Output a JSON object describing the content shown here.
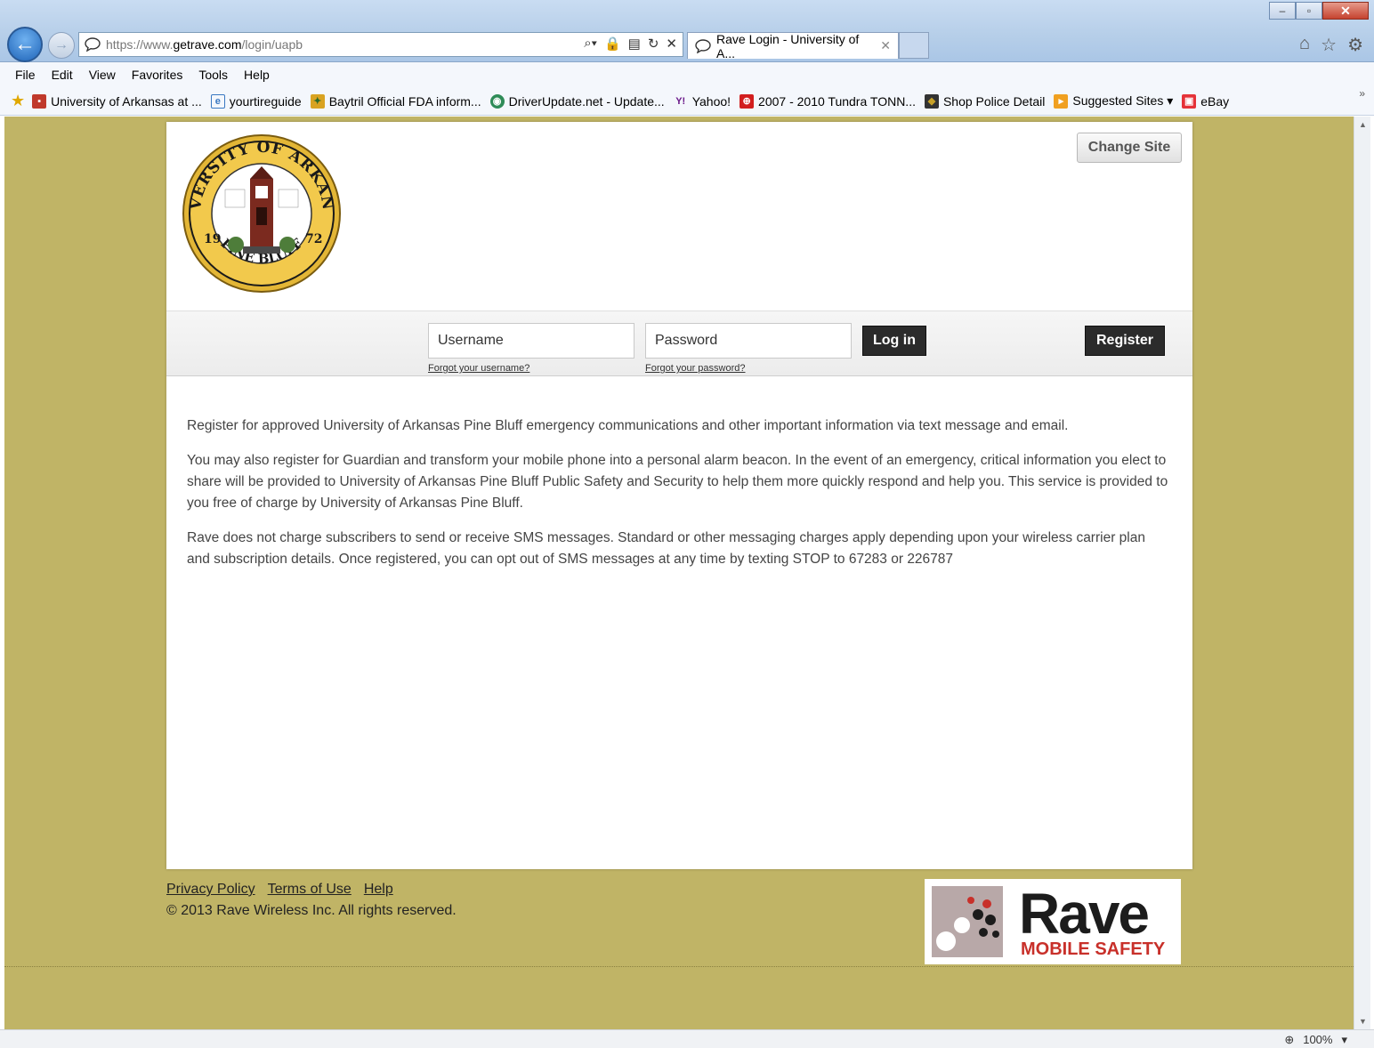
{
  "browser": {
    "url_scheme": "https://www.",
    "url_host": "getrave.com",
    "url_path": "/login/uapb",
    "tab_title": "Rave Login - University of A...",
    "menu": [
      "File",
      "Edit",
      "View",
      "Favorites",
      "Tools",
      "Help"
    ],
    "favorites": [
      {
        "label": "University of Arkansas at ...",
        "icon": "uapb-favicon-icon",
        "color": "#c0392b"
      },
      {
        "label": "yourtireguide",
        "icon": "ie-page-icon",
        "color": "#3a78c2"
      },
      {
        "label": "Baytril Official FDA inform...",
        "icon": "baytril-favicon-icon",
        "color": "#d9a321"
      },
      {
        "label": "DriverUpdate.net - Update...",
        "icon": "globe-icon",
        "color": "#2e8b57"
      },
      {
        "label": "Yahoo!",
        "icon": "yahoo-icon",
        "color": "#6b1a8a"
      },
      {
        "label": "2007 - 2010 Tundra TONN...",
        "icon": "toyota-icon",
        "color": "#d21e1e"
      },
      {
        "label": "Shop Police Detail",
        "icon": "police-shop-icon",
        "color": "#333333"
      },
      {
        "label": "Suggested Sites ▾",
        "icon": "suggested-sites-icon",
        "color": "#f0a020"
      },
      {
        "label": "eBay",
        "icon": "ebay-icon",
        "color": "#e53238"
      }
    ],
    "zoom": "100%"
  },
  "page": {
    "change_site_label": "Change Site",
    "username_placeholder": "Username",
    "password_placeholder": "Password",
    "login_label": "Log in",
    "register_label": "Register",
    "forgot_username": "Forgot your username?",
    "forgot_password": "Forgot your password?",
    "paragraphs": [
      "Register for approved University of Arkansas Pine Bluff emergency communications and other important information via text message and email.",
      "You may also register for Guardian and transform your mobile phone into a personal alarm beacon. In the event of an emergency, critical information you elect to share will be provided to University of Arkansas Pine Bluff Public Safety and Security to help them more quickly respond and help you. This service is provided to you free of charge by University of Arkansas Pine Bluff.",
      "Rave does not charge subscribers to send or receive SMS messages. Standard or other messaging charges apply depending upon your wireless carrier plan and subscription details. Once registered, you can opt out of SMS messages at any time by texting STOP to 67283 or 226787"
    ],
    "seal_top_text": "UNIVERSITY OF ARKANSAS",
    "seal_bottom_text": "PINE BLUFF",
    "seal_left_num": "19",
    "seal_right_num": "72"
  },
  "footer": {
    "links": [
      "Privacy Policy",
      "Terms of Use",
      "Help"
    ],
    "copyright": "© 2013 Rave Wireless Inc. All rights reserved.",
    "logo_word": "Rave",
    "logo_sub": "MOBILE SAFETY"
  },
  "colors": {
    "page_background": "#c0b466",
    "rave_red": "#c8302a"
  }
}
